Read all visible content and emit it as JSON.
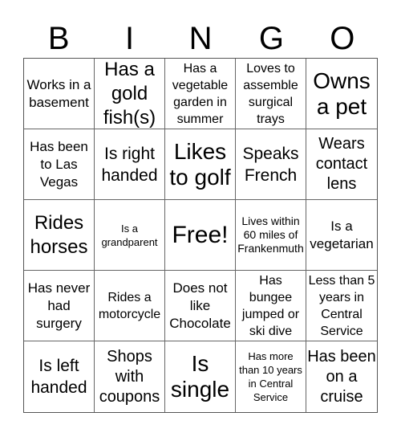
{
  "header": [
    "B",
    "I",
    "N",
    "G",
    "O"
  ],
  "cells": [
    "Works in a basement",
    "Has a gold fish(s)",
    "Has a vegetable garden in summer",
    "Loves to assemble surgical trays",
    "Owns a pet",
    "Has been to Las Vegas",
    "Is right handed",
    "Likes to golf",
    "Speaks French",
    "Wears contact lens",
    "Rides horses",
    "Is a grandparent",
    "Free!",
    "Lives within 60 miles of Frankenmuth",
    "Is a vegetarian",
    "Has never had surgery",
    "Rides a motorcycle",
    "Does not like Chocolate",
    "Has bungee jumped or ski dive",
    "Less than 5 years in Central Service",
    "Is left handed",
    "Shops with coupons",
    "Is single",
    "Has more than 10 years in Central Service",
    "Has been on a cruise"
  ]
}
